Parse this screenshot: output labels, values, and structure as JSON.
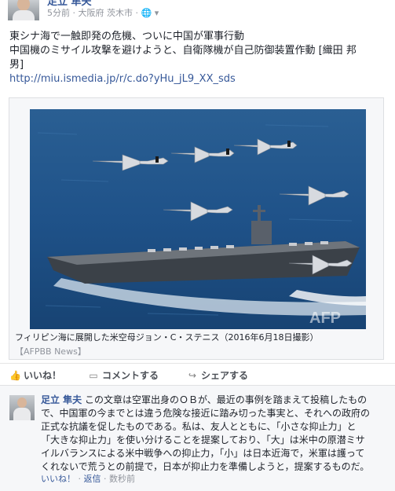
{
  "post": {
    "author": "足立 隼夫",
    "time": "5分前",
    "location": "大阪府 茨木市",
    "text_line1": "東シナ海で一触即発の危機、ついに中国が軍事行動",
    "text_line2": "中国機のミサイル攻撃を避けようと、自衛隊機が自己防御装置作動 [織田 邦",
    "text_line3": "男]",
    "link": "http://miu.ismedia.jp/r/c.do?yHu_jL9_XX_sds"
  },
  "card": {
    "caption": "フィリピン海に展開した米空母ジョン・C・ステニス（2016年6月18日撮影）",
    "source": "【AFPBB News】",
    "watermark": "AFP"
  },
  "actions": {
    "like": "いいね！",
    "comment": "コメントする",
    "share": "シェアする"
  },
  "comment": {
    "author": "足立 隼夫",
    "line1": "この文章は空軍出身のＯＢが、最近の事例を踏まえて投稿したもの",
    "line2": "で、中国軍の今までとは違う危険な接近に踏み切った事実と、それへの政府の",
    "line3": "正式な抗議を促したものである。私は、友人とともに、「小さな抑止力」と",
    "line4": "「大きな抑止力」を使い分けることを提案しており、「大」は米中の原潜ミサ",
    "line5": "イルバランスによる米中戦争への抑止力，「小」は日本近海で，米軍は護って",
    "line6": "くれないで荒うとの前提で，日本が抑止力を準備しようと，提案するものだ。",
    "like": "いいね！",
    "reply": "返信",
    "time": "数秒前"
  },
  "icons": {
    "globe": "globe-icon",
    "chevron": "chevron-down-icon",
    "like": "thumbs-up-icon",
    "comment": "speech-bubble-icon",
    "share": "share-arrow-icon"
  }
}
